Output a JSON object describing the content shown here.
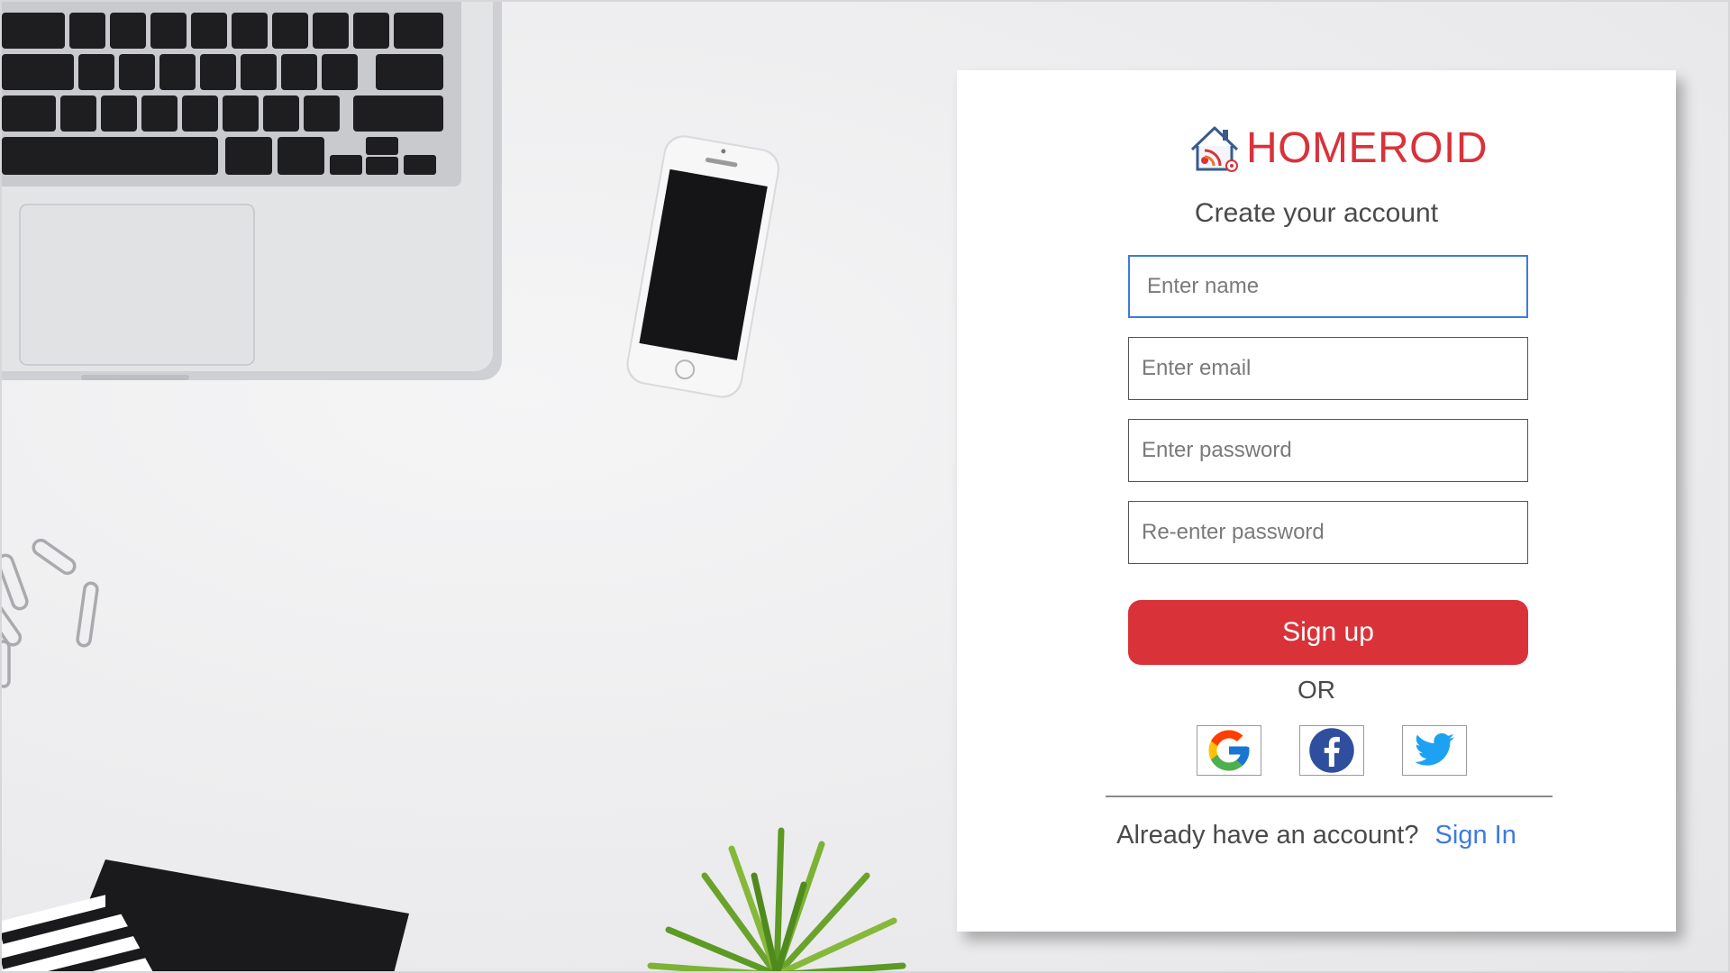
{
  "brand": {
    "name": "HOMEROID",
    "color": "#d9323a",
    "logo_icon": "house-wifi-icon"
  },
  "form": {
    "title": "Create your account",
    "fields": [
      {
        "name": "name",
        "placeholder": "Enter name",
        "value": "",
        "focused": true
      },
      {
        "name": "email",
        "placeholder": "Enter email",
        "value": ""
      },
      {
        "name": "password",
        "placeholder": "Enter password",
        "value": ""
      },
      {
        "name": "confirm_password",
        "placeholder": "Re-enter password",
        "value": ""
      }
    ],
    "submit_label": "Sign up",
    "submit_color": "#da3239"
  },
  "social": {
    "separator": "OR",
    "providers": [
      {
        "name": "Google",
        "icon": "google-icon"
      },
      {
        "name": "Facebook",
        "icon": "facebook-icon"
      },
      {
        "name": "Twitter",
        "icon": "twitter-icon"
      }
    ]
  },
  "footer": {
    "prompt": "Already have an account?",
    "link_label": "Sign In",
    "link_color": "#3d7bdc"
  },
  "background": {
    "scene": [
      "laptop",
      "smartphone",
      "paper-clips",
      "notebook",
      "plant"
    ]
  }
}
